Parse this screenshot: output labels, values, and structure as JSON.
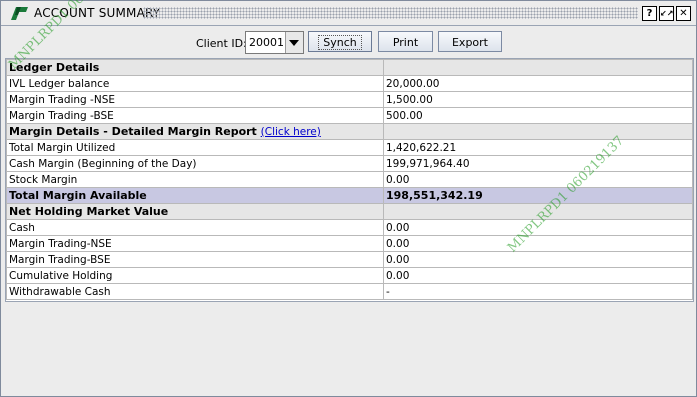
{
  "window": {
    "title": "ACCOUNT SUMMARY",
    "help_glyph": "?",
    "restore_glyph": "↙↗",
    "close_glyph": "✕"
  },
  "toolbar": {
    "client_label": "Client ID:",
    "client_id": "20001",
    "synch_label": "Synch",
    "print_label": "Print",
    "export_label": "Export"
  },
  "sections": {
    "ledger": {
      "heading": "Ledger Details",
      "rows": [
        {
          "label": "IVL Ledger balance",
          "value": "20,000.00"
        },
        {
          "label": "Margin Trading -NSE",
          "value": "1,500.00"
        },
        {
          "label": "Margin Trading -BSE",
          "value": "500.00"
        }
      ]
    },
    "margin": {
      "heading": "Margin Details - Detailed Margin Report",
      "link_text": "(Click here)",
      "rows": [
        {
          "label": "Total Margin Utilized",
          "value": "1,420,622.21"
        },
        {
          "label": "Cash Margin (Beginning of the Day)",
          "value": "199,971,964.40"
        },
        {
          "label": "Stock Margin",
          "value": "0.00"
        }
      ],
      "total": {
        "label": "Total Margin Available",
        "value": "198,551,342.19"
      }
    },
    "holding": {
      "heading": "Net Holding Market Value",
      "rows": [
        {
          "label": "Cash",
          "value": "0.00"
        },
        {
          "label": "Margin Trading-NSE",
          "value": "0.00"
        },
        {
          "label": "Margin Trading-BSE",
          "value": "0.00"
        },
        {
          "label": "Cumulative Holding",
          "value": "0.00"
        },
        {
          "label": "Withdrawable Cash",
          "value": "-"
        }
      ]
    }
  },
  "watermarks": [
    "MNPLRPD1 060219137",
    "MNPLRPD1 060219137"
  ],
  "colors": {
    "total_row_bg": "#c8c8e2",
    "section_row_bg": "#e6e6e6",
    "link": "#0000cc",
    "watermark": "#1e9a1e",
    "logo": "#1a7a3a"
  },
  "icons": {
    "app": "trading-logo-icon",
    "combo": "chevron-down-icon"
  }
}
